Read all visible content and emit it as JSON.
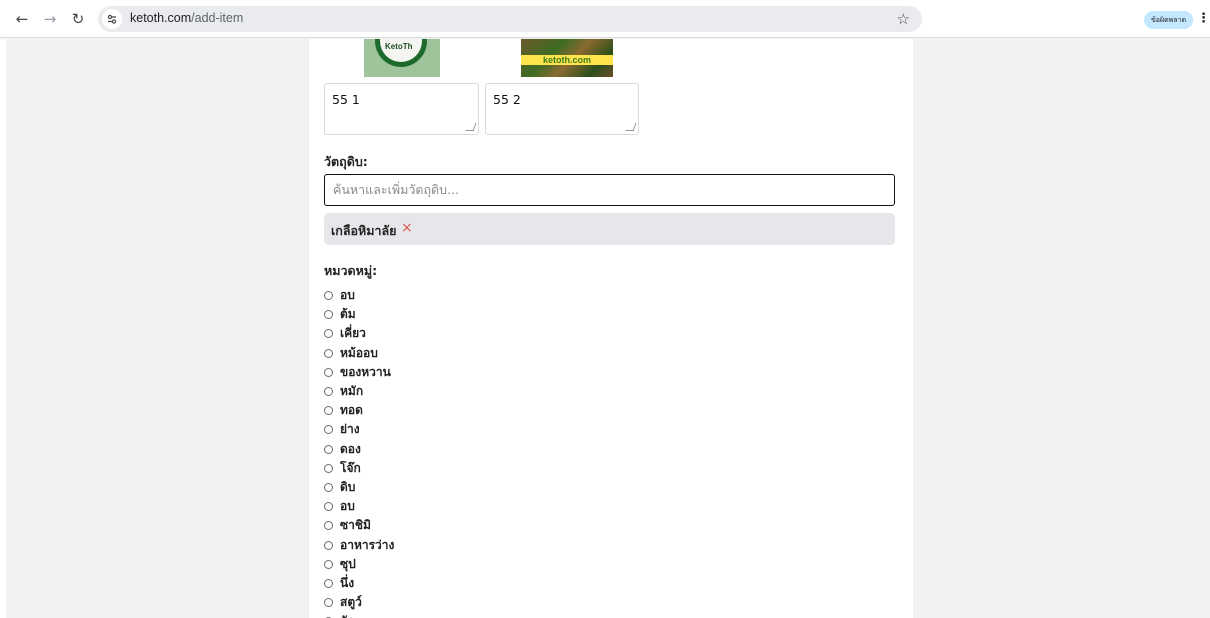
{
  "browser": {
    "url_host": "ketoth.com",
    "url_path": "/add-item",
    "error_badge": "ข้อผิดพลาด"
  },
  "images": [
    {
      "name": "KetoTh logo",
      "logo_text": "KetoTh"
    },
    {
      "name": "ketoth.com banner",
      "band_text": "ketoth.com"
    }
  ],
  "textareas": [
    {
      "value": "55 1"
    },
    {
      "value": "55 2"
    }
  ],
  "ingredients": {
    "label": "วัตถุดิบ:",
    "placeholder": "ค้นหาและเพิ่มวัตถุดิบ...",
    "selected": [
      {
        "label": "เกลือหิมาลัย",
        "remove_glyph": "×"
      }
    ]
  },
  "category": {
    "label": "หมวดหมู่:",
    "options": [
      "อบ",
      "ต้ม",
      "เคี่ยว",
      "หม้ออบ",
      "ของหวาน",
      "หมัก",
      "ทอด",
      "ย่าง",
      "ดอง",
      "โจ๊ก",
      "ดิบ",
      "อบ",
      "ซาชิมิ",
      "อาหารว่าง",
      "ซุป",
      "นึ่ง",
      "สตูว์",
      "ผัด"
    ]
  },
  "colors": {
    "page_bg": "#f2f2f2",
    "chip_bg": "#e6e7ea",
    "remove_icon": "#e05757",
    "error_badge_bg": "#c2e7ff"
  }
}
